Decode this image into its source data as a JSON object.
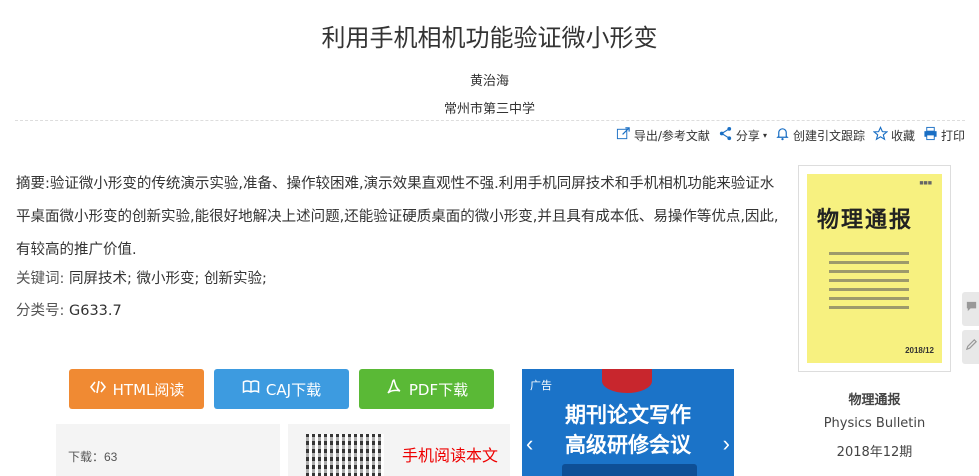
{
  "article": {
    "title": "利用手机相机功能验证微小形变",
    "author": "黄治海",
    "organization": "常州市第三中学"
  },
  "toolbar": {
    "export_label": "导出/参考文献",
    "share_label": "分享",
    "alert_label": "创建引文跟踪",
    "favorite_label": "收藏",
    "print_label": "打印"
  },
  "abstract": {
    "label": "摘要:",
    "text": "验证微小形变的传统演示实验,准备、操作较困难,演示效果直观性不强.利用手机同屏技术和手机相机功能来验证水平桌面微小形变的创新实验,能很好地解决上述问题,还能验证硬质桌面的微小形变,并且具有成本低、易操作等优点,因此,有较高的推广价值."
  },
  "keywords": {
    "label": "关键词:",
    "items": [
      "同屏技术;",
      "微小形变;",
      "创新实验;"
    ]
  },
  "classification": {
    "label": "分类号:",
    "value": "G633.7"
  },
  "journal": {
    "cover_title": "物理通报",
    "cover_date": "2018/12",
    "name_cn": "物理通报",
    "name_en": "Physics Bulletin",
    "issue": "2018年12期"
  },
  "buttons": {
    "html_label": "HTML阅读",
    "caj_label": "CAJ下载",
    "pdf_label": "PDF下载"
  },
  "downloads": {
    "label": "下载：63"
  },
  "mobile": {
    "label": "手机阅读本文"
  },
  "ad": {
    "tag": "广告",
    "line1": "期刊论文写作",
    "line2": "高级研修会议"
  },
  "colors": {
    "html_button": "#f08a33",
    "caj_button": "#3d9be0",
    "pdf_button": "#5ab936",
    "ad_bg": "#1b73c8",
    "mobile_text": "#e00000"
  }
}
